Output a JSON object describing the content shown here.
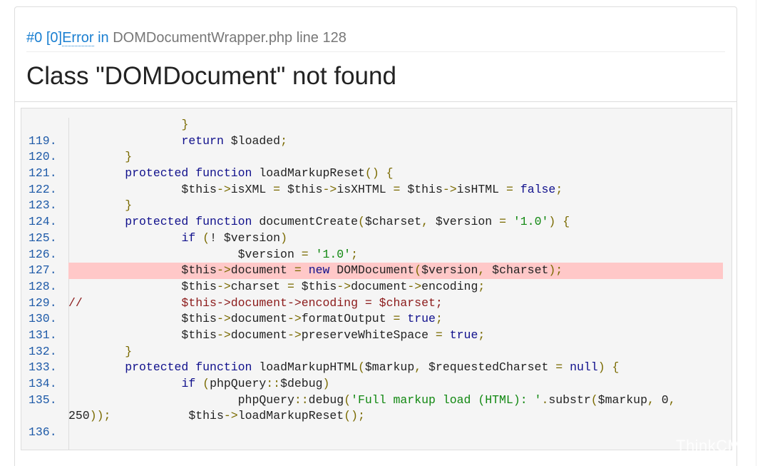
{
  "header": {
    "trace_index": "#0",
    "code_prefix": "[0]",
    "error_type": "Error",
    "in_word": "in",
    "file": "DOMDocumentWrapper.php",
    "line_word": "line",
    "line_number": "128"
  },
  "message": "Class \"DOMDocument\" not found",
  "source": {
    "highlight_line": "127.",
    "lines": [
      {
        "num": "",
        "code": "                }"
      },
      {
        "num": "119.",
        "code": "                return $loaded;"
      },
      {
        "num": "120.",
        "code": "        }"
      },
      {
        "num": "121.",
        "code": "        protected function loadMarkupReset() {"
      },
      {
        "num": "122.",
        "code": "                $this->isXML = $this->isXHTML = $this->isHTML = false;"
      },
      {
        "num": "123.",
        "code": "        }"
      },
      {
        "num": "124.",
        "code": "        protected function documentCreate($charset, $version = '1.0') {"
      },
      {
        "num": "125.",
        "code": "                if (! $version)"
      },
      {
        "num": "126.",
        "code": "                        $version = '1.0';"
      },
      {
        "num": "127.",
        "code": "                $this->document = new DOMDocument($version, $charset);"
      },
      {
        "num": "128.",
        "code": "                $this->charset = $this->document->encoding;"
      },
      {
        "num": "129.",
        "code": "//              $this->document->encoding = $charset;"
      },
      {
        "num": "130.",
        "code": "                $this->document->formatOutput = true;"
      },
      {
        "num": "131.",
        "code": "                $this->document->preserveWhiteSpace = true;"
      },
      {
        "num": "132.",
        "code": "        }"
      },
      {
        "num": "133.",
        "code": "        protected function loadMarkupHTML($markup, $requestedCharset = null) {"
      },
      {
        "num": "134.",
        "code": "                if (phpQuery::$debug)"
      },
      {
        "num": "135.",
        "code": "                        phpQuery::debug('Full markup load (HTML): '.substr($markup, 0,\n250));           $this->loadMarkupReset();"
      },
      {
        "num": "136.",
        "code": ""
      }
    ]
  },
  "watermark": "ThinkCMF",
  "colors": {
    "link_blue": "#1a7fd1",
    "line_number": "#1e5aa8",
    "keyword": "#10108c",
    "string": "#118811",
    "highlight_bg": "#ffc8c8",
    "comment": "#8b1a1a"
  }
}
